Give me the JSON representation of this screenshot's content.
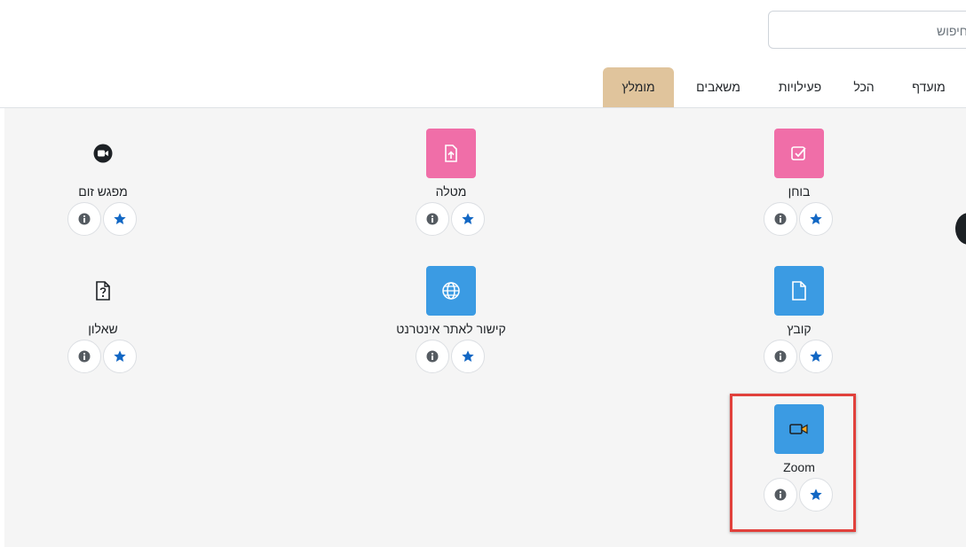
{
  "search": {
    "placeholder": "חיפוש"
  },
  "tabs": [
    {
      "label": "מועדף"
    },
    {
      "label": "הכל"
    },
    {
      "label": "פעילויות"
    },
    {
      "label": "משאבים"
    },
    {
      "label": "מומלץ",
      "active": true
    }
  ],
  "modules": [
    {
      "label": "בוחן",
      "icon": "quiz-icon",
      "tile_color": "#f06ea8"
    },
    {
      "label": "מטלה",
      "icon": "assignment-icon",
      "tile_color": "#f06ea8"
    },
    {
      "label": "מפגש זום",
      "icon": "zoom-meeting-icon"
    },
    {
      "label": "קובץ",
      "icon": "file-icon",
      "tile_color": "#3b9be3"
    },
    {
      "label": "קישור לאתר אינטרנט",
      "icon": "globe-icon",
      "tile_color": "#3b9be3"
    },
    {
      "label": "שאלון",
      "icon": "questionnaire-icon"
    },
    {
      "label": "Zoom",
      "icon": "zoom-camera-icon",
      "tile_color": "#3b9be3",
      "highlighted": true
    }
  ],
  "colors": {
    "active_tab": "#e0c49c",
    "star": "#1267c4",
    "highlight": "#e1413c"
  }
}
